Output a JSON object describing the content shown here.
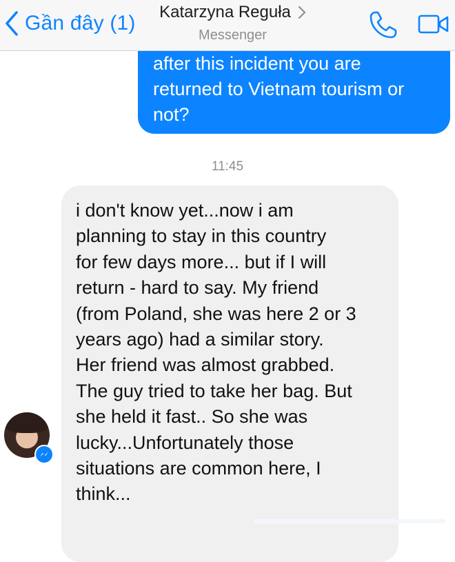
{
  "header": {
    "back_label": "Gần đây (1)",
    "title": "Katarzyna Reguła",
    "subtitle": "Messenger",
    "icons": {
      "back": "chevron-left-icon",
      "title": "chevron-right-icon",
      "call": "phone-icon",
      "video": "video-camera-icon"
    },
    "accent_color": "#0d84ff"
  },
  "conversation": {
    "outgoing": {
      "lines": [
        "after this incident you are",
        "returned to Vietnam tourism or",
        "not?"
      ],
      "bubble_color": "#0d84ff"
    },
    "timestamp": "11:45",
    "incoming": {
      "lines": [
        "i don't know yet...now i am",
        "planning to stay in this country",
        "for few days more... but if I will",
        "return - hard to say. My friend",
        "(from Poland, she was here 2 or 3",
        "years ago) had a similar story.",
        "Her friend was almost grabbed.",
        "The guy tried to take her bag. But",
        "she held it fast.. So she was",
        "lucky...Unfortunately those",
        "situations are common here, I",
        "think..."
      ],
      "bubble_color": "#f1f0f0"
    },
    "sender_badge_icon": "messenger-icon"
  }
}
